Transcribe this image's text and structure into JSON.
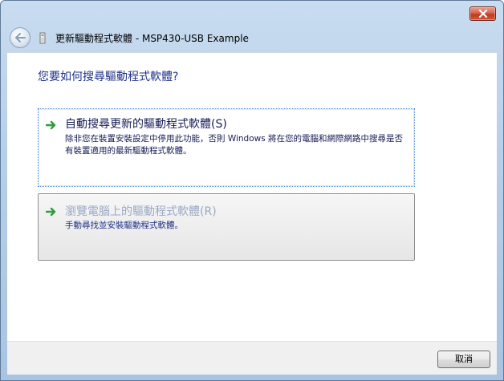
{
  "window": {
    "close_icon": "close-icon"
  },
  "nav": {
    "back_icon": "back-arrow-icon",
    "wizard_icon": "wizard-device-icon",
    "title": "更新驅動程式軟體 - MSP430-USB Example"
  },
  "main": {
    "heading": "您要如何搜尋驅動程式軟體?",
    "options": [
      {
        "icon": "green-arrow-icon",
        "title": "自動搜尋更新的驅動程式軟體(S)",
        "description": "除非您在裝置安裝設定中停用此功能，否則 Windows 將在您的電腦和網際網路中搜尋是否有裝置適用的最新驅動程式軟體。"
      },
      {
        "icon": "green-arrow-icon",
        "title": "瀏覽電腦上的驅動程式軟體(R)",
        "description": "手動尋找並安裝驅動程式軟體。"
      }
    ]
  },
  "footer": {
    "cancel_label": "取消"
  },
  "colors": {
    "heading": "#1e3287",
    "arrow": "#2e9e3a",
    "close_button": "#c13a1d",
    "frame": "#b7cfe8"
  }
}
